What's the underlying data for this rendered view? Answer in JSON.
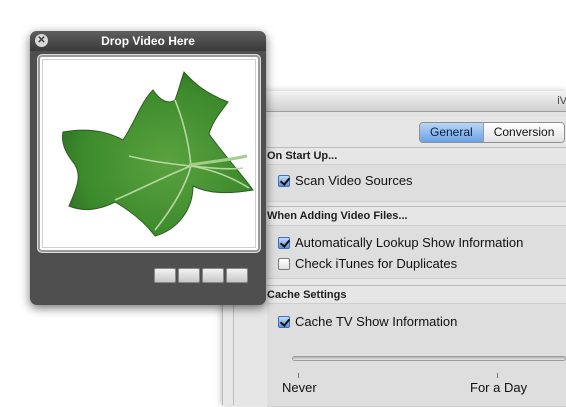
{
  "prefs": {
    "window_title_fragment": "iV",
    "tabs": [
      {
        "label": "General",
        "active": true
      },
      {
        "label": "Conversion",
        "active": false
      }
    ],
    "sections": {
      "startup": {
        "heading": "On Start Up...",
        "options": [
          {
            "label": "Scan Video Sources",
            "checked": true
          }
        ]
      },
      "adding": {
        "heading": "When Adding Video Files...",
        "options": [
          {
            "label": "Automatically Lookup Show Information",
            "checked": true
          },
          {
            "label": "Check iTunes for Duplicates",
            "checked": false
          }
        ]
      },
      "cache": {
        "heading": "Cache Settings",
        "options": [
          {
            "label": "Cache TV Show Information",
            "checked": true
          }
        ],
        "slider_labels": [
          "Never",
          "For a Day"
        ]
      }
    }
  },
  "hud": {
    "title": "Drop Video Here",
    "close_glyph": "✕",
    "image": "ivy-leaf-artwork",
    "button_count": 4
  },
  "colors": {
    "accent": "#6aa1e6",
    "hud_background": "#4f4f4f",
    "leaf_green": "#3f8a2f"
  }
}
